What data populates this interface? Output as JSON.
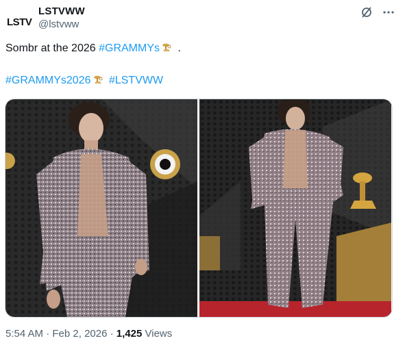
{
  "author": {
    "display_name": "LSTVWW",
    "handle": "@lstvww",
    "avatar_letters": "LSTV"
  },
  "header_actions": {
    "grok_icon": "slashed-circle-icon",
    "more_icon": "more-dots-icon"
  },
  "tweet": {
    "line1_prefix": "Sombr at the 2026 ",
    "hashtag_grammys": "#GRAMMYs",
    "line1_suffix": " .",
    "hashtag_grammys2026": "#GRAMMYs2026",
    "hashtag_lstvww": "#LSTVWW"
  },
  "meta": {
    "time": "5:54 AM",
    "date": "Feb 2, 2026",
    "views_count": "1,425",
    "views_label": "Views",
    "separator": "·"
  },
  "colors": {
    "link": "#1d9bf0",
    "secondary_text": "#536471",
    "primary_text": "#0f1419"
  }
}
